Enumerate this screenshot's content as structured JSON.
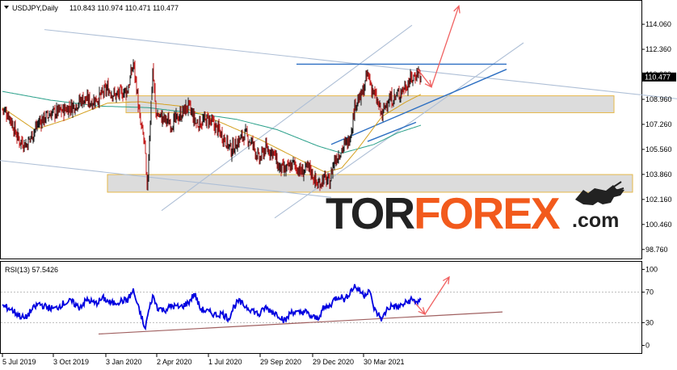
{
  "colors": {
    "bull": "#1a1a1a",
    "bear": "#c21b1b",
    "ma_fast": "#d4a020",
    "ma_slow": "#2aa08a",
    "trend_gray": "#aebfd6",
    "trend_blue": "#2d6fc2",
    "arrow": "#f06060",
    "rsi": "#0000e0",
    "rsi_support": "#a06060",
    "zone_fill": "#d6d6d6",
    "zone_border": "#e6b84a",
    "wm_dark": "#222222",
    "wm_orange": "#f25a1c"
  },
  "chart_data": [
    {
      "type": "candlestick",
      "title": "USDJPY,Daily",
      "ohlc_readout": "110.843 110.974 110.471 110.477",
      "current_price_label": "110.477",
      "current_price": 110.477,
      "ylim": [
        98.2,
        115.6
      ],
      "y_ticks": [
        "114.060",
        "112.360",
        "110.660",
        "108.960",
        "107.260",
        "105.560",
        "103.860",
        "102.160",
        "100.460",
        "98.760"
      ],
      "x_ticks": [
        "5 Jul 2019",
        "3 Oct 2019",
        "3 Jan 2020",
        "2 Apr 2020",
        "1 Jul 2020",
        "29 Sep 2020",
        "29 Dec 2020",
        "30 Mar 2021"
      ],
      "closes_anchor": [
        [
          0,
          108.3
        ],
        [
          8,
          107.9
        ],
        [
          20,
          106.2
        ],
        [
          30,
          105.9
        ],
        [
          45,
          107.4
        ],
        [
          60,
          108.0
        ],
        [
          75,
          108.2
        ],
        [
          90,
          108.6
        ],
        [
          100,
          109.0
        ],
        [
          110,
          108.8
        ],
        [
          120,
          109.1
        ],
        [
          130,
          109.7
        ],
        [
          140,
          109.2
        ],
        [
          155,
          109.6
        ],
        [
          162,
          111.4
        ],
        [
          166,
          109.8
        ],
        [
          170,
          107.5
        ],
        [
          176,
          106.0
        ],
        [
          179,
          102.5
        ],
        [
          182,
          106.5
        ],
        [
          186,
          111.0
        ],
        [
          190,
          108.0
        ],
        [
          200,
          107.6
        ],
        [
          210,
          107.3
        ],
        [
          220,
          107.9
        ],
        [
          230,
          108.5
        ],
        [
          240,
          107.3
        ],
        [
          255,
          107.6
        ],
        [
          265,
          107.0
        ],
        [
          275,
          106.3
        ],
        [
          283,
          105.5
        ],
        [
          290,
          106.0
        ],
        [
          300,
          106.6
        ],
        [
          310,
          105.9
        ],
        [
          318,
          104.8
        ],
        [
          325,
          105.6
        ],
        [
          335,
          105.4
        ],
        [
          342,
          104.3
        ],
        [
          350,
          104.1
        ],
        [
          360,
          104.6
        ],
        [
          370,
          104.0
        ],
        [
          380,
          104.3
        ],
        [
          390,
          103.1
        ],
        [
          397,
          103.6
        ],
        [
          405,
          103.3
        ],
        [
          410,
          104.7
        ],
        [
          420,
          105.6
        ],
        [
          428,
          106.1
        ],
        [
          432,
          107.0
        ],
        [
          437,
          108.8
        ],
        [
          443,
          109.0
        ],
        [
          448,
          109.8
        ],
        [
          452,
          110.7
        ],
        [
          458,
          109.6
        ],
        [
          465,
          108.6
        ],
        [
          470,
          107.8
        ],
        [
          476,
          108.9
        ],
        [
          483,
          109.0
        ],
        [
          490,
          109.3
        ],
        [
          498,
          109.8
        ],
        [
          505,
          110.3
        ],
        [
          510,
          110.5
        ],
        [
          514,
          110.9
        ],
        [
          518,
          110.5
        ]
      ],
      "ma_fast_anchor": [
        [
          0,
          108.4
        ],
        [
          40,
          106.9
        ],
        [
          80,
          107.6
        ],
        [
          130,
          108.7
        ],
        [
          170,
          108.8
        ],
        [
          220,
          108.5
        ],
        [
          270,
          107.4
        ],
        [
          320,
          106.2
        ],
        [
          370,
          104.8
        ],
        [
          400,
          104.0
        ],
        [
          420,
          104.3
        ],
        [
          440,
          105.6
        ],
        [
          470,
          107.8
        ],
        [
          500,
          108.8
        ],
        [
          518,
          109.3
        ]
      ],
      "ma_slow_anchor": [
        [
          0,
          109.5
        ],
        [
          60,
          108.9
        ],
        [
          120,
          108.5
        ],
        [
          180,
          108.4
        ],
        [
          240,
          108.0
        ],
        [
          290,
          107.6
        ],
        [
          340,
          106.9
        ],
        [
          390,
          105.8
        ],
        [
          420,
          105.3
        ],
        [
          460,
          105.9
        ],
        [
          490,
          106.7
        ],
        [
          518,
          107.2
        ]
      ],
      "zones": [
        {
          "name": "resistance-zone",
          "x_from": 156,
          "x_to": 760,
          "y_from": 108.05,
          "y_to": 109.2
        },
        {
          "name": "support-zone",
          "x_from": 133,
          "x_to": 783,
          "y_from": 102.65,
          "y_to": 103.85
        }
      ],
      "trendlines": [
        {
          "name": "long-downtrend",
          "color": "trend_gray",
          "x1": 55,
          "y1": 113.7,
          "x2": 838,
          "y2": 109.0
        },
        {
          "name": "long-lower-channel",
          "color": "trend_gray",
          "x1": 0,
          "y1": 104.8,
          "x2": 410,
          "y2": 102.3
        },
        {
          "name": "channel-top",
          "color": "trend_gray",
          "x1": 200,
          "y1": 101.4,
          "x2": 510,
          "y2": 114.0
        },
        {
          "name": "channel-bottom",
          "color": "trend_gray",
          "x1": 340,
          "y1": 100.9,
          "x2": 648,
          "y2": 112.8
        },
        {
          "name": "horizontal-resistance",
          "color": "trend_blue",
          "x1": 367,
          "y1": 111.35,
          "x2": 627,
          "y2": 111.35
        },
        {
          "name": "upper-trend",
          "color": "trend_blue",
          "x1": 410,
          "y1": 105.9,
          "x2": 627,
          "y2": 111.0
        },
        {
          "name": "lower-trend",
          "color": "trend_blue",
          "x1": 455,
          "y1": 106.1,
          "x2": 515,
          "y2": 107.4
        }
      ],
      "arrows": [
        {
          "name": "down-arrow",
          "points": [
            [
              517,
              111.0
            ],
            [
              534,
              109.8
            ]
          ]
        },
        {
          "name": "up-arrow",
          "points": [
            [
              534,
              109.8
            ],
            [
              568,
              115.3
            ]
          ]
        }
      ]
    },
    {
      "type": "line",
      "title": "RSI(13) 57.5426",
      "ylim": [
        -10,
        110
      ],
      "y_ticks": [
        "100",
        "70",
        "30",
        "0"
      ],
      "levels": [
        100,
        70,
        30,
        0
      ],
      "values_anchor": [
        [
          0,
          52
        ],
        [
          10,
          48
        ],
        [
          20,
          40
        ],
        [
          28,
          35
        ],
        [
          35,
          45
        ],
        [
          45,
          55
        ],
        [
          55,
          50
        ],
        [
          65,
          48
        ],
        [
          75,
          55
        ],
        [
          85,
          58
        ],
        [
          95,
          50
        ],
        [
          105,
          60
        ],
        [
          115,
          55
        ],
        [
          125,
          62
        ],
        [
          135,
          55
        ],
        [
          145,
          58
        ],
        [
          155,
          60
        ],
        [
          162,
          72
        ],
        [
          168,
          50
        ],
        [
          173,
          35
        ],
        [
          176,
          20
        ],
        [
          180,
          40
        ],
        [
          186,
          65
        ],
        [
          192,
          50
        ],
        [
          200,
          46
        ],
        [
          210,
          52
        ],
        [
          220,
          50
        ],
        [
          230,
          56
        ],
        [
          238,
          68
        ],
        [
          245,
          48
        ],
        [
          255,
          44
        ],
        [
          265,
          40
        ],
        [
          272,
          42
        ],
        [
          280,
          35
        ],
        [
          286,
          50
        ],
        [
          292,
          58
        ],
        [
          300,
          52
        ],
        [
          310,
          46
        ],
        [
          318,
          40
        ],
        [
          325,
          50
        ],
        [
          333,
          45
        ],
        [
          342,
          40
        ],
        [
          350,
          32
        ],
        [
          358,
          45
        ],
        [
          366,
          42
        ],
        [
          374,
          45
        ],
        [
          382,
          38
        ],
        [
          390,
          35
        ],
        [
          397,
          48
        ],
        [
          405,
          52
        ],
        [
          412,
          62
        ],
        [
          418,
          65
        ],
        [
          424,
          60
        ],
        [
          430,
          70
        ],
        [
          436,
          78
        ],
        [
          442,
          72
        ],
        [
          448,
          66
        ],
        [
          454,
          74
        ],
        [
          458,
          55
        ],
        [
          462,
          44
        ],
        [
          466,
          40
        ],
        [
          470,
          34
        ],
        [
          476,
          48
        ],
        [
          482,
          52
        ],
        [
          490,
          50
        ],
        [
          498,
          55
        ],
        [
          506,
          60
        ],
        [
          512,
          58
        ],
        [
          518,
          57
        ]
      ],
      "support": {
        "x1": 122,
        "y1": 15,
        "x2": 622,
        "y2": 44
      },
      "arrows": [
        {
          "name": "rsi-down-arrow",
          "points": [
            [
              512,
              58
            ],
            [
              526,
              41
            ]
          ]
        },
        {
          "name": "rsi-up-arrow",
          "points": [
            [
              526,
              41
            ],
            [
              556,
              90
            ]
          ]
        }
      ]
    }
  ],
  "watermark": {
    "part1": "TOR",
    "part2": "FOREX",
    "part3": ".com"
  }
}
